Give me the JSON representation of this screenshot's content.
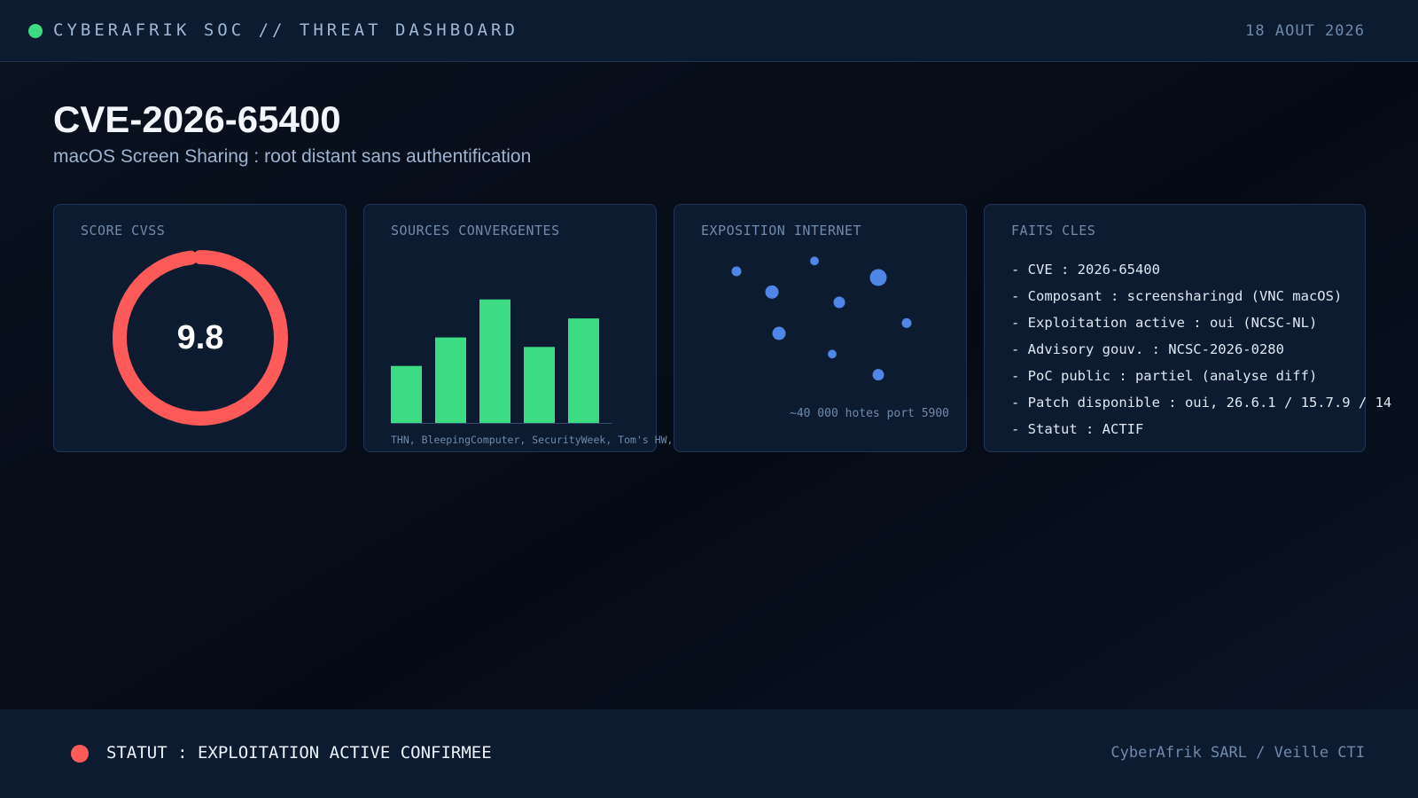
{
  "header": {
    "brand": "CYBERAFRIK SOC // THREAT DASHBOARD",
    "date": "18 AOUT 2026",
    "status_dot_color": "#3ddc84"
  },
  "page": {
    "title": "CVE-2026-65400",
    "subtitle": "macOS Screen Sharing : root distant sans authentification"
  },
  "cards": {
    "cvss": {
      "title": "SCORE CVSS",
      "score": "9.8",
      "score_value": 9.8,
      "score_max": 10,
      "ring_color": "#ff5a5a"
    },
    "sources": {
      "title": "SOURCES CONVERGENTES",
      "caption": "THN, BleepingComputer, SecurityWeek, Tom's HW,",
      "bar_color": "#3ddc84"
    },
    "exposure": {
      "title": "EXPOSITION INTERNET",
      "caption": "~40 000 hotes port 5900",
      "dot_color": "#4f86e8"
    },
    "facts": {
      "title": "FAITS CLES",
      "items": [
        "- CVE : 2026-65400",
        "- Composant : screensharingd (VNC macOS)",
        "- Exploitation active : oui (NCSC-NL)",
        "- Advisory gouv. : NCSC-2026-0280",
        "- PoC public : partiel (analyse diff)",
        "- Patch disponible : oui, 26.6.1 / 15.7.9 / 14",
        "- Statut : ACTIF"
      ]
    }
  },
  "chart_data": [
    {
      "type": "bar",
      "values": [
        3,
        4.5,
        6.5,
        4,
        5.5
      ],
      "ylim": [
        0,
        7
      ]
    },
    {
      "type": "scatter",
      "points": [
        {
          "x": 1.0,
          "y": 7.5,
          "size": 1
        },
        {
          "x": 2.0,
          "y": 6.5,
          "size": 2
        },
        {
          "x": 3.2,
          "y": 8.0,
          "size": 0.7
        },
        {
          "x": 3.9,
          "y": 6.0,
          "size": 1.5
        },
        {
          "x": 5.0,
          "y": 7.2,
          "size": 3
        },
        {
          "x": 5.8,
          "y": 5.0,
          "size": 1
        },
        {
          "x": 2.2,
          "y": 4.5,
          "size": 2
        },
        {
          "x": 3.7,
          "y": 3.5,
          "size": 0.7
        },
        {
          "x": 5.0,
          "y": 2.5,
          "size": 1.5
        }
      ],
      "xlim": [
        0,
        7
      ],
      "ylim": [
        0,
        9
      ]
    }
  ],
  "footer": {
    "status": "STATUT : EXPLOITATION ACTIVE CONFIRMEE",
    "status_color": "#ff5a5a",
    "org": "CyberAfrik SARL / Veille CTI"
  }
}
